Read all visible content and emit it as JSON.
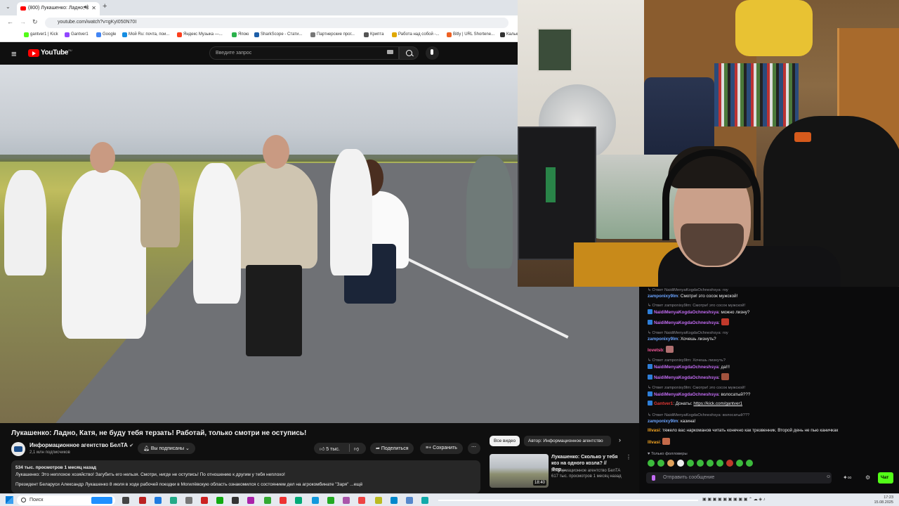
{
  "browser": {
    "tab_title": "(800) Лукашенко: Ладно, К",
    "url": "youtube.com/watch?v=gKyI050N70I",
    "bookmarks": [
      {
        "label": "gantver1 | Kick",
        "color": "#53fc18"
      },
      {
        "label": "Gantver1",
        "color": "#9146ff"
      },
      {
        "label": "Google",
        "color": "#4285f4"
      },
      {
        "label": "Мой Ru: почта, пои...",
        "color": "#168de2"
      },
      {
        "label": "Яндекс Музыка —...",
        "color": "#fc3f1d"
      },
      {
        "label": "Япою",
        "color": "#2bb24c"
      },
      {
        "label": "SharkScope - Стати...",
        "color": "#1d5ea8"
      },
      {
        "label": "Партнерские прог...",
        "color": "#777777"
      },
      {
        "label": "Крипта",
        "color": "#555555"
      },
      {
        "label": "Работа над собой -...",
        "color": "#e0a800"
      },
      {
        "label": "Bitly | URL Shortene...",
        "color": "#ee6123"
      },
      {
        "label": "Калькул...",
        "color": "#333333"
      }
    ]
  },
  "youtube": {
    "logo": "YouTube",
    "logo_region": "RU",
    "search_placeholder": "Введите запрос",
    "video_title": "Лукашенко: Ладно, Катя, не буду тебя терзать! Работай, только смотри не оступись!",
    "channel_name": "Информационное агентство БелТА",
    "channel_subs": "2,1 млн подписчиков",
    "subscribed_label": "Вы подписаны",
    "likes": "5 тыс.",
    "share_label": "Поделиться",
    "save_label": "Сохранить",
    "views_line": "534 тыс. просмотров  1 месяц назад",
    "desc_line1": "Лукашенко: Это неплохое хозяйство! Загубить его нельзя. Смотри, нигде не оступись! По отношению к другим у тебя неплохо!",
    "desc_line2": "Президент Беларуси Александр Лукашенко 8 июля в ходе рабочей поездки в Могилёвскую область ознакомился с состоянием дел на агрокомбинате \"Заря\"  ...ещё",
    "chips": [
      "Все видео",
      "Автор: Информационное агентство"
    ],
    "rec_title": "Лукашенко: Сколько у тебя коз на одного козла? // Фер...",
    "rec_channel": "Информационное агентство БелТА",
    "rec_meta": "617 тыс. просмотров  1 месяц назад",
    "rec_duration": "18:40"
  },
  "chat": {
    "messages": [
      {
        "type": "reply",
        "text": "Ответ NaidiMenyaKogdaOchneshsya: гоу"
      },
      {
        "type": "msg",
        "nick": "zamponixy9lm",
        "color": "#6ba4ff",
        "text": ": Смотри! это сосок мужской!"
      },
      {
        "type": "reply",
        "text": "Ответ zamponixy9lm: Смотри! это сосок мужской!"
      },
      {
        "type": "msg",
        "nick": "NaidiMenyaKogdaOchneshsya",
        "color": "#c36cf4",
        "text": ": можно лизну?",
        "badge": true
      },
      {
        "type": "msg",
        "nick": "NaidiMenyaKogdaOchneshsya",
        "color": "#c36cf4",
        "text": ":",
        "badge": true,
        "emote": "#c0392b"
      },
      {
        "type": "reply",
        "text": "Ответ NaidiMenyaKogdaOchneshsya: гоу"
      },
      {
        "type": "msg",
        "nick": "zamponixy9lm",
        "color": "#6ba4ff",
        "text": ": Хочешь лизнуть?"
      },
      {
        "type": "msg",
        "nick": "lovetsb",
        "color": "#ff5aa0",
        "text": ":",
        "emote": "#b07070"
      },
      {
        "type": "reply",
        "text": "Ответ zamponixy9lm: Хочешь лизнуть?"
      },
      {
        "type": "msg",
        "nick": "NaidiMenyaKogdaOchneshsya",
        "color": "#c36cf4",
        "text": ": да!!!",
        "badge": true
      },
      {
        "type": "msg",
        "nick": "NaidiMenyaKogdaOchneshsya",
        "color": "#c36cf4",
        "text": ":",
        "badge": true,
        "emote": "#a0523d"
      },
      {
        "type": "reply",
        "text": "Ответ zamponixy9lm: Смотри! это сосок мужской!"
      },
      {
        "type": "msg",
        "nick": "NaidiMenyaKogdaOchneshsya",
        "color": "#c36cf4",
        "text": ": волосатый???",
        "badge": true
      },
      {
        "type": "msg",
        "nick": "Gantver1",
        "color": "#e53935",
        "text": ": Донаты: ",
        "link": "https://kick.com/gantver1",
        "badge": true
      },
      {
        "type": "reply",
        "text": "Ответ NaidiMenyaKogdaOchneshsya: волосатый???"
      },
      {
        "type": "msg",
        "nick": "zamponixy9lm",
        "color": "#6ba4ff",
        "text": ": казина!"
      },
      {
        "type": "msg",
        "nick": "lllvasi",
        "color": "#f5a623",
        "text": ": тяжело вас наркоманов читать конечно как трезвенник. Второй день не пью каничкак"
      },
      {
        "type": "msg",
        "nick": "lllvasi",
        "color": "#f5a623",
        "text": ":",
        "emote": "#c46a4a"
      }
    ],
    "followers_only": "Только фолловеры",
    "input_placeholder": "Отправить сообщение",
    "send_label": "Чат"
  },
  "taskbar": {
    "search_label": "Поиск",
    "time": "17:23",
    "date": "15.08.2025"
  }
}
